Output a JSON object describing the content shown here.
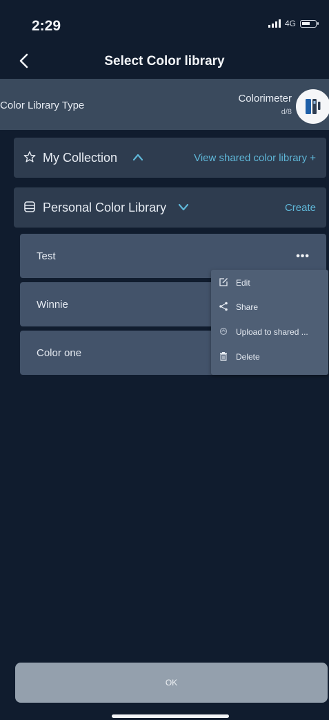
{
  "status_bar": {
    "time": "2:29",
    "network": "4G",
    "icons": [
      "signal-icon",
      "battery-icon"
    ]
  },
  "header": {
    "title": "Select Color library",
    "back_icon": "chevron-left-icon"
  },
  "library_type": {
    "label": "Color Library Type",
    "device_name": "Colorimeter",
    "device_geometry": "d/8",
    "device_icon": "colorimeter-device-icon"
  },
  "my_collection": {
    "label": "My Collection",
    "icon": "star-outline-icon",
    "chevron": "chevron-up-icon",
    "action": "View shared color library +"
  },
  "personal_library": {
    "label": "Personal Color Library",
    "icon": "database-icon",
    "chevron": "chevron-down-icon",
    "action": "Create"
  },
  "libraries": [
    {
      "name": "Test",
      "has_more": true
    },
    {
      "name": "Winnie"
    },
    {
      "name": "Color one"
    }
  ],
  "more_label": "•••",
  "context_menu": [
    {
      "icon": "edit-icon",
      "label": "Edit"
    },
    {
      "icon": "share-icon",
      "label": "Share"
    },
    {
      "icon": "upload-icon",
      "label": "Upload to shared ..."
    },
    {
      "icon": "trash-icon",
      "label": "Delete"
    }
  ],
  "footer": {
    "ok_label": "OK"
  },
  "colors": {
    "background": "#101c2e",
    "section": "#2e3c4f",
    "row": "#43536a",
    "menu": "#4f5f75",
    "accent": "#5fb7d8",
    "ok_button": "#94a0ad"
  }
}
